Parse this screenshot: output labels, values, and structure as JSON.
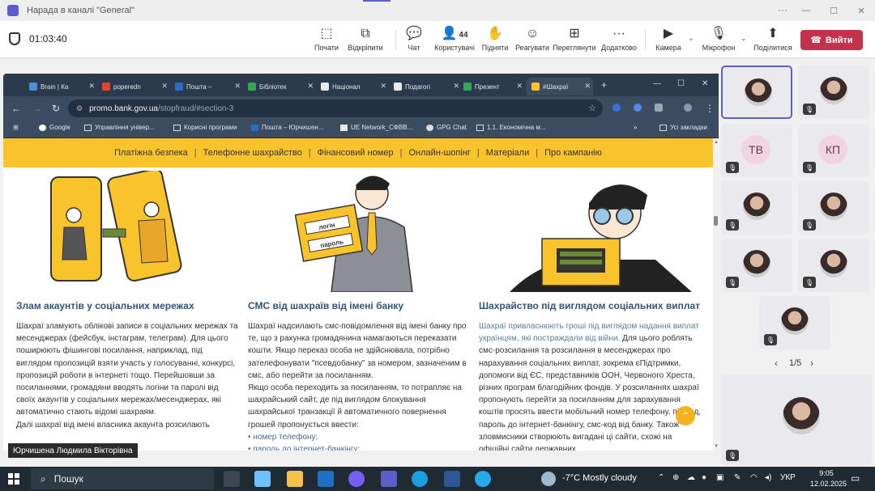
{
  "window": {
    "title": "Нарада в каналі \"General\""
  },
  "meeting_toolbar": {
    "timer": "01:03:40",
    "buttons": {
      "start": "Почати",
      "pop_out": "Відкріпити",
      "chat": "Чат",
      "people": "Користувачі",
      "people_count": "44",
      "raise": "Підняти",
      "react": "Реагувати",
      "view": "Переглянути",
      "more": "Додатково",
      "camera": "Камера",
      "mic": "Мікрофон",
      "share": "Поділитися"
    },
    "leave": "Вийти",
    "leave_color": "#c4314b"
  },
  "browser": {
    "tabs": [
      {
        "label": "Brain | Ка"
      },
      {
        "label": "poperedn"
      },
      {
        "label": "Пошта – "
      },
      {
        "label": "Бібліотек"
      },
      {
        "label": "Націонал"
      },
      {
        "label": "Подагогі"
      },
      {
        "label": "Презент"
      },
      {
        "label": "#Шахраї"
      }
    ],
    "url_host": "promo.bank.gov.ua",
    "url_path": "/stopfraud/#section-3",
    "bookmarks": [
      "Google",
      "Управління універ...",
      "Корисні програми",
      "Пошта – Юрчишен...",
      "UE Network_СФВВ...",
      "GPG Chat",
      "1.1. Економічна м..."
    ],
    "bookmarks_more": "»",
    "all_bookmarks": "Усі закладки"
  },
  "site": {
    "nav": [
      "Платіжна безпека",
      "Телефонне шахрайство",
      "Фінансовий номер",
      "Онлайн-шопінг",
      "Матеріали",
      "Про кампанію"
    ],
    "nav_separator": "|",
    "illus_labels": {
      "login": "логін",
      "password": "пароль"
    },
    "columns": [
      {
        "title": "Злам акаунтів у соціальних мережах",
        "paragraphs": [
          "Шахраї зламують облікові записи в соціальних мережах та месенджерах (фейсбук, інстаграм, телеграм). Для цього поширюють фішингові посилання, наприклад, під виглядом пропозицій взяти участь у голосуванні, конкурсі, пропозицій роботи в інтернеті тощо. Перейшовши за посиланнями, громадяни вводять логіни та паролі від своїх акаунтів у соціальних мережах/месенджерах, які автоматично стають відомі шахраям.",
          "Далі шахраї від імені власника акаунта розсилають"
        ]
      },
      {
        "title": "СМС від шахраїв від імені банку",
        "paragraphs": [
          "Шахраї надсилають смс-повідомлення від імені банку про те, що з рахунка громадянина намагаються переказати кошти. Якщо переказ особа не здійснювала, потрібно зателефонувати \"псевдобанку\" за номером, зазначеним в смс, або перейти за посиланням.",
          "Якщо особа переходить за посиланням, то потрапляє на шахрайський сайт, де під виглядом блокування шахрайської транзакції й автоматичного повернення грошей пропонується ввести:"
        ],
        "list": [
          "• номер телефону;",
          "• пароль до інтернет-банкінгу;"
        ]
      },
      {
        "title": "Шахрайство під виглядом соціальних виплат",
        "lead": "Шахраї привласнюють гроші під виглядом надання виплат українцям, які постраждали від війни.",
        "paragraphs": [
          "Для цього роблять смс-розсилання та розсилання в месенджерах про нарахування соціальних виплат, зокрема єПідтримки, допомоги від ЄС, представників ООН, Червоного Хреста, різних програм благодійних фондів. У розсиланнях шахраї пропонують перейти за посиланням для зарахування коштів просять ввести мобільний номер телефону, пін-код, пароль до інтернет-банкінгу, смс-код від банку. Також зловмисники створюють вигадані ці сайти, схожі на офіційні сайти державних"
        ]
      }
    ],
    "accent": "#f9c32c"
  },
  "presenter": {
    "name": "Юрчишена Людмила Вікторівна"
  },
  "participants": {
    "initials": [
      "ТВ",
      "КП"
    ],
    "pager": "1/5"
  },
  "taskbar": {
    "search_placeholder": "Пошук",
    "weather": "-7°C  Mostly cloudy",
    "lang": "УКР",
    "time": "9:05",
    "date": "12.02.2025"
  }
}
